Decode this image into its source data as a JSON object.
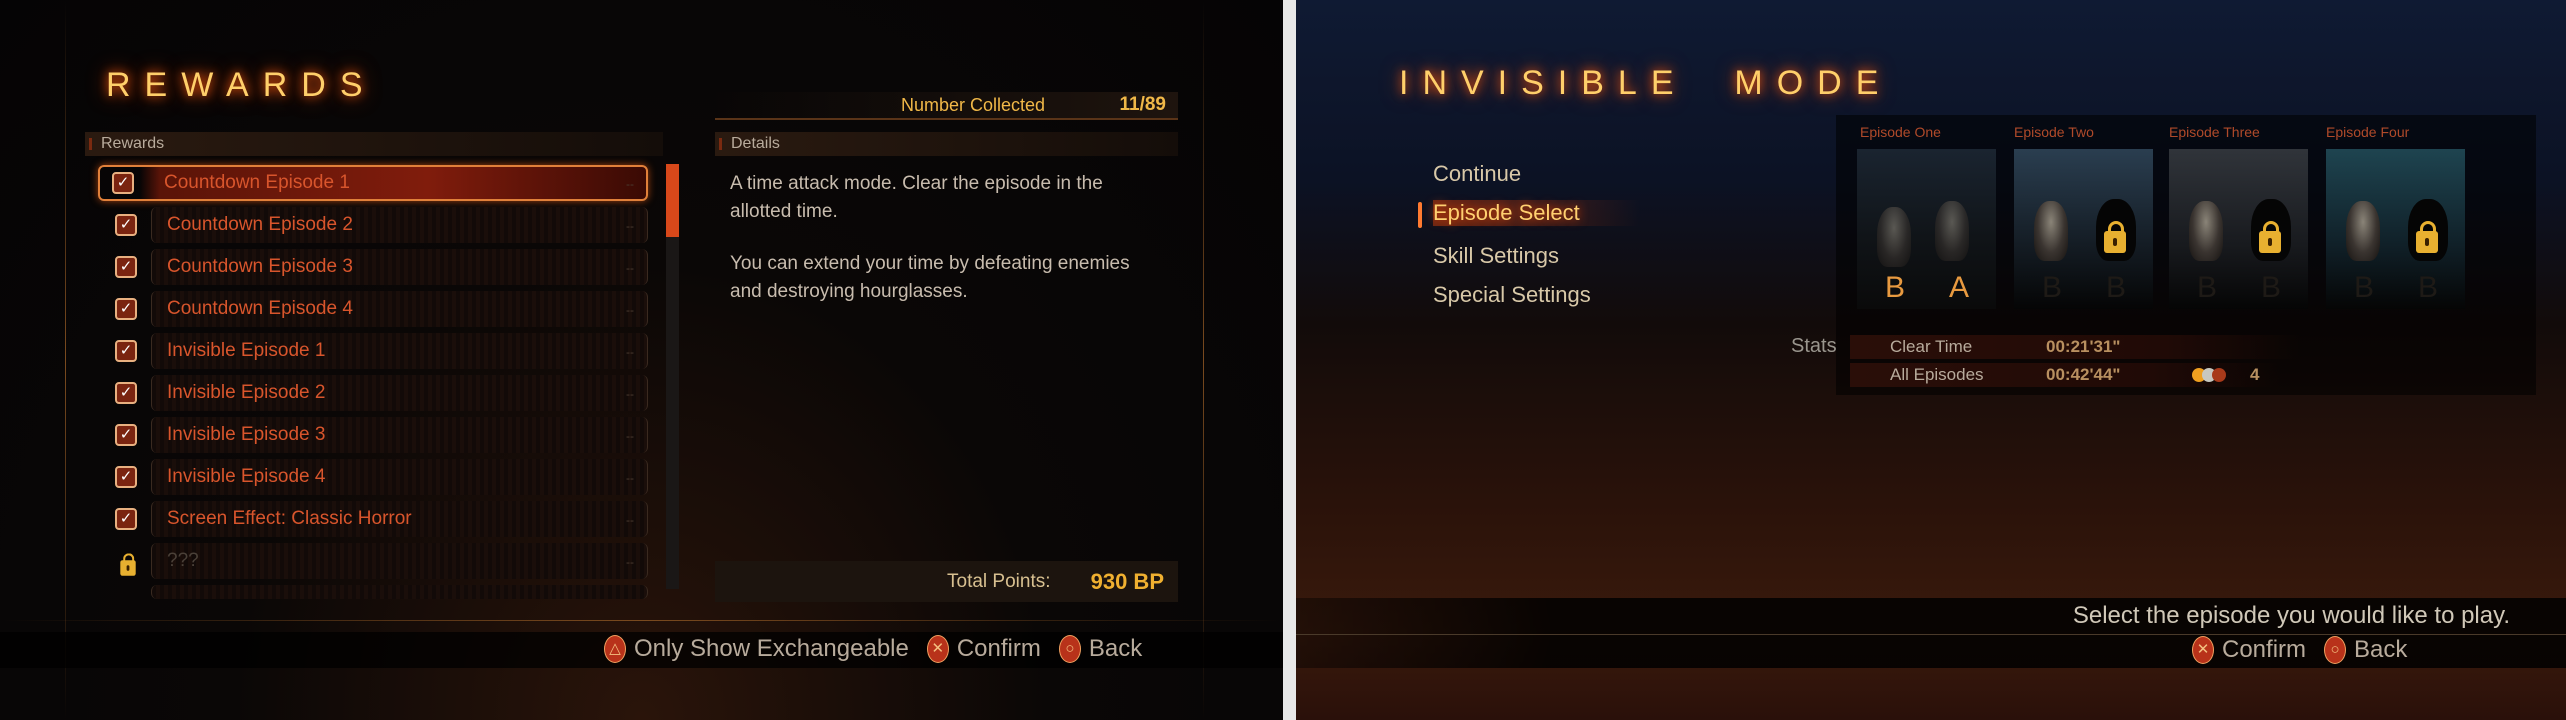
{
  "rewards_screen": {
    "title": "REWARDS",
    "number_collected_label": "Number Collected",
    "number_collected_value": "11/89",
    "list_header": "Rewards",
    "details_header": "Details",
    "items": [
      {
        "label": "Countdown Episode 1",
        "status": "checked",
        "selected": true
      },
      {
        "label": "Countdown Episode 2",
        "status": "checked"
      },
      {
        "label": "Countdown Episode 3",
        "status": "checked"
      },
      {
        "label": "Countdown Episode 4",
        "status": "checked"
      },
      {
        "label": "Invisible Episode 1",
        "status": "checked"
      },
      {
        "label": "Invisible Episode 2",
        "status": "checked"
      },
      {
        "label": "Invisible Episode 3",
        "status": "checked"
      },
      {
        "label": "Invisible Episode 4",
        "status": "checked"
      },
      {
        "label": "Screen Effect: Classic Horror",
        "status": "checked"
      },
      {
        "label": "???",
        "status": "locked"
      }
    ],
    "item_cost_placeholder": "--",
    "check_glyph": "✓",
    "lock_glyph": "🔒",
    "details_paragraphs": [
      "A time attack mode. Clear the episode in the allotted time.",
      "You can extend your time by defeating enemies and destroying hourglasses."
    ],
    "total_points_label": "Total Points:",
    "total_points_value": "930 BP",
    "buttons": [
      {
        "glyph": "△",
        "icon": "triangle-button-icon",
        "label": "Only Show Exchangeable"
      },
      {
        "glyph": "✕",
        "icon": "cross-button-icon",
        "label": "Confirm"
      },
      {
        "glyph": "○",
        "icon": "circle-button-icon",
        "label": "Back"
      }
    ]
  },
  "invisible_screen": {
    "title": "INVISIBLE  MODE",
    "menu": [
      {
        "label": "Continue"
      },
      {
        "label": "Episode Select",
        "selected": true
      },
      {
        "label": "Skill Settings"
      },
      {
        "label": "Special Settings"
      }
    ],
    "episodes": [
      {
        "label": "Episode One",
        "ranks": [
          "B",
          "A"
        ],
        "locked": false
      },
      {
        "label": "Episode Two",
        "ranks": [
          "B",
          "B"
        ],
        "locked": true
      },
      {
        "label": "Episode Three",
        "ranks": [
          "B",
          "B"
        ],
        "locked": true
      },
      {
        "label": "Episode Four",
        "ranks": [
          "B",
          "B"
        ],
        "locked": true
      }
    ],
    "stats": {
      "label": "Stats",
      "rows": [
        {
          "label": "Clear Time",
          "value": "00:21'31\""
        },
        {
          "label": "All Episodes",
          "value": "00:42'44\"",
          "medal_count": "4"
        }
      ]
    },
    "message": "Select the episode you would like to play.",
    "buttons": [
      {
        "glyph": "✕",
        "icon": "cross-button-icon",
        "label": "Confirm"
      },
      {
        "glyph": "○",
        "icon": "circle-button-icon",
        "label": "Back"
      }
    ]
  },
  "colors": {
    "accent": "#e0803a",
    "title_glow": "#ff5a10",
    "item_text": "#d8552c",
    "gold": "#e8b030"
  }
}
